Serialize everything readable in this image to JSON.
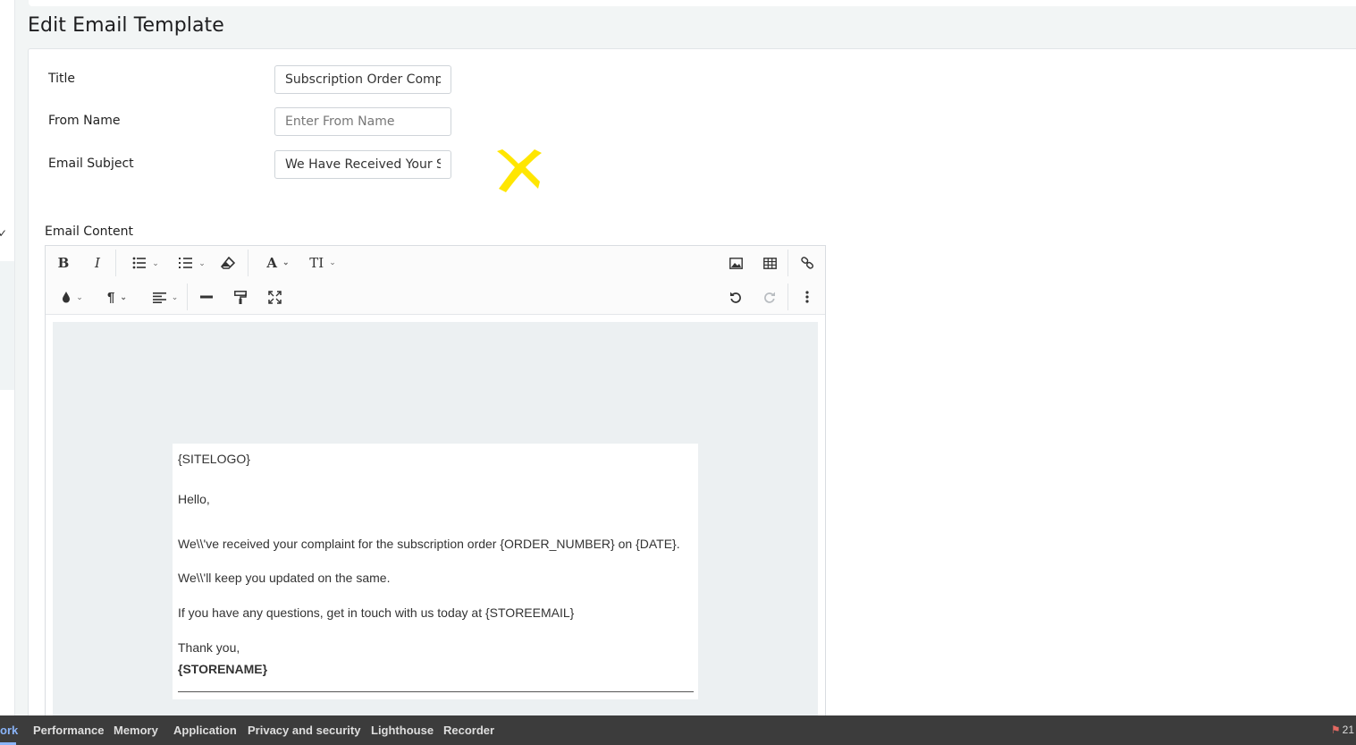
{
  "page": {
    "title": "Edit Email Template"
  },
  "form": {
    "title_label": "Title",
    "title_value": "Subscription Order Comp",
    "from_name_label": "From Name",
    "from_name_value": "",
    "from_name_placeholder": "Enter From Name",
    "subject_label": "Email Subject",
    "subject_value": "We Have Received Your S"
  },
  "editor": {
    "label": "Email Content",
    "toolbar_row1": [
      "bold-icon",
      "italic-icon",
      "bullet-list-icon",
      "numbered-list-icon",
      "eraser-icon",
      "font-color-icon",
      "font-size-icon",
      "image-icon",
      "table-icon",
      "link-icon"
    ],
    "toolbar_row2": [
      "highlight-icon",
      "paragraph-icon",
      "align-icon",
      "horizontal-rule-icon",
      "format-painter-icon",
      "fullscreen-icon",
      "undo-icon",
      "redo-icon",
      "more-icon"
    ],
    "glyphs": {
      "bold": "B",
      "italic": "I",
      "font_color": "A",
      "font_size": "TI",
      "paragraph": "¶"
    }
  },
  "email": {
    "logo": "{SITELOGO}",
    "greeting": "Hello,",
    "line1": "We\\\\'ve received your complaint for the subscription order {ORDER_NUMBER} on {DATE}.",
    "line2": "We\\\\'ll keep you updated on the same.",
    "line3": "If you have any questions, get in touch with us today at {STOREEMAIL}",
    "closing": "Thank you,",
    "store_name": "{STORENAME}"
  },
  "devtools": {
    "tabs": [
      "ork",
      "Performance",
      "Memory",
      "Application",
      "Privacy and security",
      "Lighthouse",
      "Recorder"
    ],
    "issues_count": "21"
  },
  "colors": {
    "annotation": "#ffe600",
    "devtools_bg": "#3c3c3c",
    "devtools_active": "#8ab4f8",
    "canvas_bg": "#ecf0f2"
  }
}
